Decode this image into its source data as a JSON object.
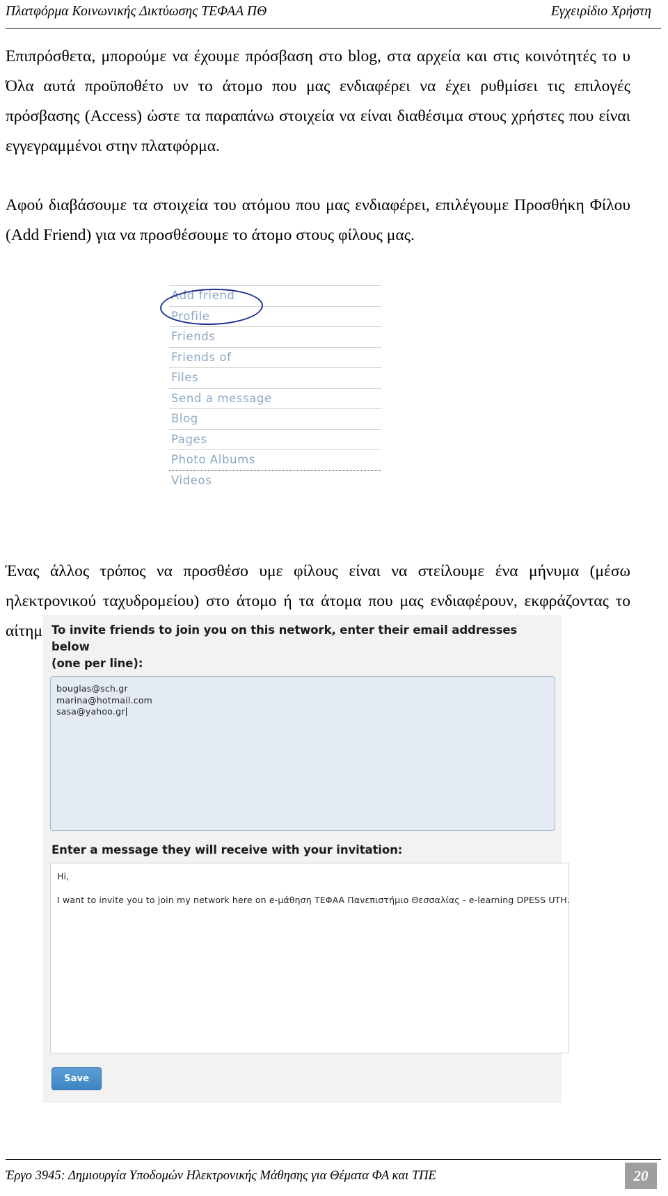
{
  "header": {
    "left": "Πλατφόρμα Κοινωνικής Δικτύωσης ΤΕΦΑΑ ΠΘ",
    "right": "Εγχειρίδιο Χρήστη"
  },
  "body": {
    "paragraph_1": "Επιπρόσθετα, μπορούμε να έχουμε πρόσβαση στο blog, στα αρχεία και στις κοινότητές το υ Όλα αυτά προϋποθέτο υν το άτομο που μας ενδιαφέρει να έχει ρυθμίσει τις επιλογές πρόσβασης (Access) ώστε τα παραπάνω στοιχεία να είναι διαθέσιμα στους χρήστες που είναι εγγεγραμμένοι στην πλατφόρμα.",
    "paragraph_2": "Αφού διαβάσουμε τα στοιχεία του ατόμου που μας ενδιαφέρει, επιλέγουμε Προσθήκη Φίλου (Add Friend) για να προσθέσουμε το άτομο στους φίλους μας.",
    "paragraph_3": "Ένας άλλος τρόπος να προσθέσο υμε φίλους είναι να στείλουμε ένα μήνυμα (μέσω ηλεκτρονικού ταχυδρομείου) στο άτομο ή τα άτομα που μας ενδιαφέρουν, εκφράζοντας το αίτημά μας για φιλία:"
  },
  "friend_menu": {
    "highlight_color": "#1c2f8f",
    "link_color": "#8aa8c6",
    "items": [
      {
        "label": "Add friend",
        "highlighted": true
      },
      {
        "label": "Profile",
        "highlighted": false
      },
      {
        "label": "Friends",
        "highlighted": false
      },
      {
        "label": "Friends of",
        "highlighted": false
      },
      {
        "label": "Files",
        "highlighted": false
      },
      {
        "label": "Send a message",
        "highlighted": false
      },
      {
        "label": "Blog",
        "highlighted": false
      },
      {
        "label": "Pages",
        "highlighted": false
      },
      {
        "label": "Photo Albums",
        "highlighted": false
      },
      {
        "label": "Videos",
        "highlighted": false
      }
    ]
  },
  "invite_form": {
    "instruction_line_1": "To invite friends to join you on this network, enter their email addresses below",
    "instruction_line_2": "(one per line):",
    "emails": [
      "bouglas@sch.gr",
      "marina@hotmail.com",
      "sasa@yahoo.gr"
    ],
    "message_label": "Enter a message they will receive with your invitation:",
    "message_lines": [
      "Hi,",
      "",
      "I want to invite you to join my network here on e-μάθηση ΤΕΦΑΑ Πανεπιστήμιο Θεσσαλίας - e-learning DPESS UTH."
    ],
    "save_label": "Save",
    "save_color": "#4a90cd"
  },
  "footer": {
    "text": "Έργο 3945: Δημιουργία Υποδομών Ηλεκτρονικής Μάθησης για Θέματα ΦΑ και ΤΠΕ",
    "page_number": "20"
  }
}
